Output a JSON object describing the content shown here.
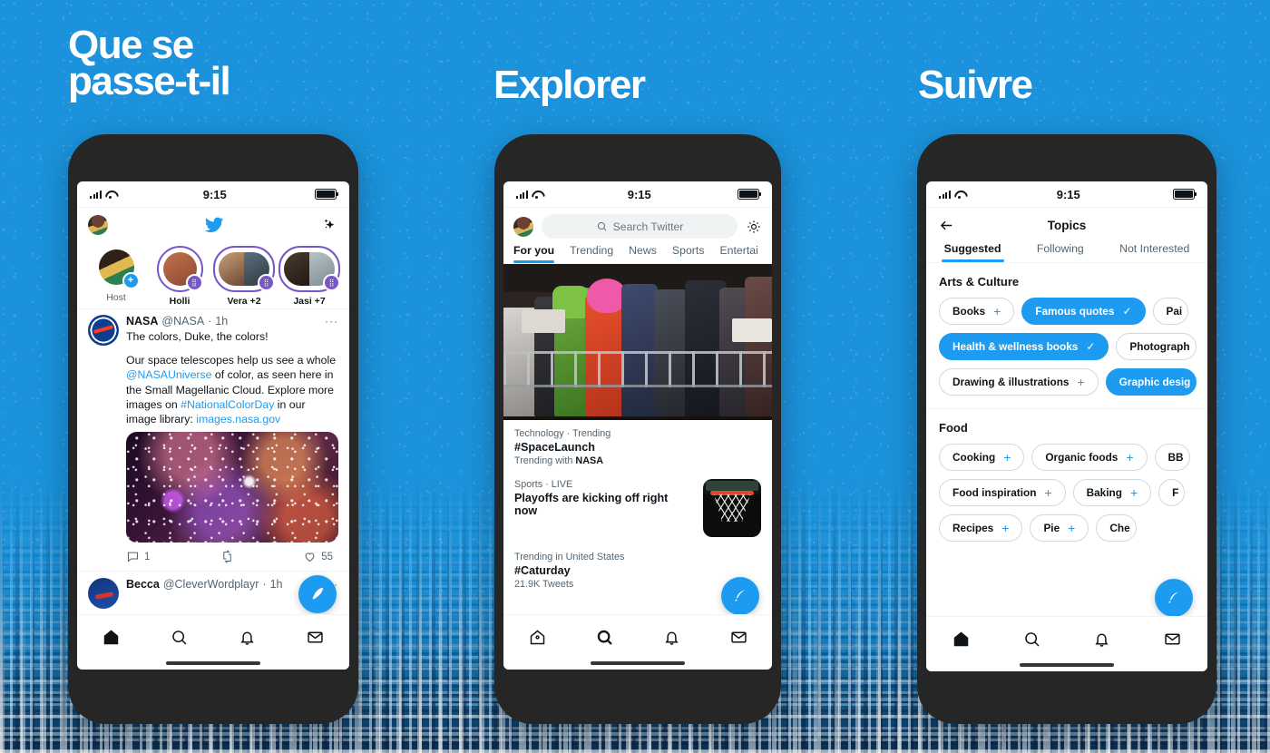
{
  "headings": {
    "panel1": "Que se\npasse-t-il",
    "panel2": "Explorer",
    "panel3": "Suivre"
  },
  "colors": {
    "background_blue": "#1b92db",
    "twitter_blue": "#1d9bf0",
    "fleet_purple": "#7856c9",
    "text_primary": "#0f1419",
    "text_muted": "#536471"
  },
  "status_bar": {
    "time": "9:15"
  },
  "phone1": {
    "header": {
      "avatar": "profile-avatar",
      "logo": "twitter-bird-logo",
      "sparkle": "sparkles-icon"
    },
    "fleets": [
      {
        "name": "Host",
        "badge": "+",
        "ringed": false
      },
      {
        "name": "Holli",
        "badge": "spaces-icon",
        "ringed": true
      },
      {
        "name": "Vera +2",
        "badge": "spaces-icon",
        "ringed": true
      },
      {
        "name": "Jasi +7",
        "badge": "spaces-icon",
        "ringed": true
      }
    ],
    "tweet": {
      "name": "NASA",
      "handle": "@NASA",
      "separator": "·",
      "time": "1h",
      "more": "···",
      "line1": "The colors, Duke, the colors!",
      "body_start": "Our space telescopes help us see a whole ",
      "mention": "@NASAUniverse",
      "body_mid": " of color, as seen here in the Small Magellanic Cloud. Explore more images on ",
      "hashtag": "#NationalColorDay",
      "body_end": " in our image library: ",
      "link": "images.nasa.gov",
      "image_alt": "nebula-photo",
      "replies": "1",
      "retweets": "",
      "likes": "55"
    },
    "tweet2": {
      "name": "Becca",
      "handle": "@CleverWordplayr",
      "separator": "·",
      "time": "1h",
      "more": "···"
    },
    "nav": [
      "home-icon",
      "search-icon",
      "notifications-icon",
      "messages-icon"
    ],
    "active_nav": "home",
    "fab": "compose-tweet-button"
  },
  "phone2": {
    "search": {
      "placeholder": "Search Twitter",
      "icon": "search-icon"
    },
    "settings_icon": "gear-icon",
    "tabs": [
      "For you",
      "Trending",
      "News",
      "Sports",
      "Entertai"
    ],
    "active_tab": "For you",
    "hero_image_alt": "crowd-of-fans-photo",
    "trends": [
      {
        "category": "Technology · Trending",
        "title": "#SpaceLaunch",
        "subtitle_prefix": "Trending with ",
        "subtitle_bold": "NASA",
        "thumb": null
      },
      {
        "category": "Sports · LIVE",
        "title": "Playoffs are kicking off right now",
        "subtitle_prefix": "",
        "subtitle_bold": "",
        "thumb": "basketball-hoop-photo"
      },
      {
        "category": "Trending in United States",
        "title": "#Caturday",
        "subtitle_prefix": "21.9K Tweets",
        "subtitle_bold": "",
        "thumb": null
      }
    ],
    "nav": [
      "home-icon",
      "search-icon",
      "notifications-icon",
      "messages-icon"
    ],
    "active_nav": "search",
    "fab": "compose-tweet-button"
  },
  "phone3": {
    "back_icon": "back-arrow-icon",
    "title": "Topics",
    "tabs": [
      "Suggested",
      "Following",
      "Not Interested"
    ],
    "active_tab": "Suggested",
    "sections": [
      {
        "heading": "Arts & Culture",
        "chips": [
          {
            "label": "Books",
            "sign": "+",
            "selected": false
          },
          {
            "label": "Famous quotes",
            "sign": "✓",
            "selected": true
          },
          {
            "label": "Pai",
            "sign": "",
            "selected": false
          },
          {
            "label": "Health & wellness books",
            "sign": "✓",
            "selected": true
          },
          {
            "label": "Photograph",
            "sign": "",
            "selected": false
          },
          {
            "label": "Drawing & illustrations",
            "sign": "+",
            "selected": false
          },
          {
            "label": "Graphic desig",
            "sign": "",
            "selected": true
          }
        ]
      },
      {
        "heading": "Food",
        "chips": [
          {
            "label": "Cooking",
            "sign": "+",
            "selected": false
          },
          {
            "label": "Organic foods",
            "sign": "+",
            "selected": false
          },
          {
            "label": "BB",
            "sign": "",
            "selected": false
          },
          {
            "label": "Food inspiration",
            "sign": "+",
            "selected": false
          },
          {
            "label": "Baking",
            "sign": "+",
            "selected": false
          },
          {
            "label": "F",
            "sign": "",
            "selected": false
          },
          {
            "label": "Recipes",
            "sign": "+",
            "selected": false
          },
          {
            "label": "Pie",
            "sign": "+",
            "selected": false
          },
          {
            "label": "Che",
            "sign": "",
            "selected": false
          }
        ]
      }
    ],
    "nav": [
      "home-icon",
      "search-icon",
      "notifications-icon",
      "messages-icon"
    ],
    "active_nav": "home",
    "fab": "compose-tweet-button"
  }
}
